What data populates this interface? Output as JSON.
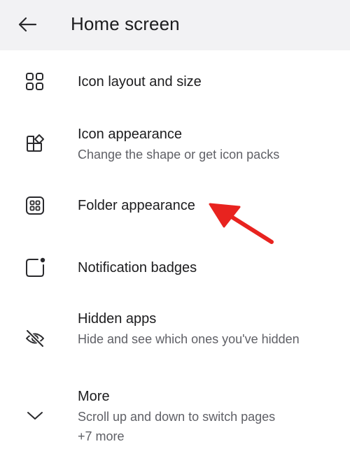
{
  "header": {
    "title": "Home screen",
    "back_icon": "arrow-left-icon",
    "background": "#f2f2f4"
  },
  "items": [
    {
      "label": "Icon layout and size",
      "icon": "grid-icon"
    },
    {
      "label": "Icon appearance",
      "sublabel": "Change the shape or get icon packs",
      "icon": "shapes-icon"
    },
    {
      "label": "Folder appearance",
      "icon": "folder-grid-icon"
    },
    {
      "label": "Notification badges",
      "icon": "badge-square-icon"
    },
    {
      "label": "Hidden apps",
      "sublabel": "Hide and see which ones you've hidden",
      "icon": "eye-off-icon"
    },
    {
      "label": "More",
      "sublabel": "Scroll up and down to switch pages",
      "extra": "+7 more",
      "icon": "chevron-down-icon"
    }
  ],
  "annotation": {
    "icon": "red-arrow-icon",
    "color": "#e8231f"
  },
  "colors": {
    "text": "#1c1c1e",
    "secondary": "#5f6066",
    "icon": "#2a2a2d"
  }
}
